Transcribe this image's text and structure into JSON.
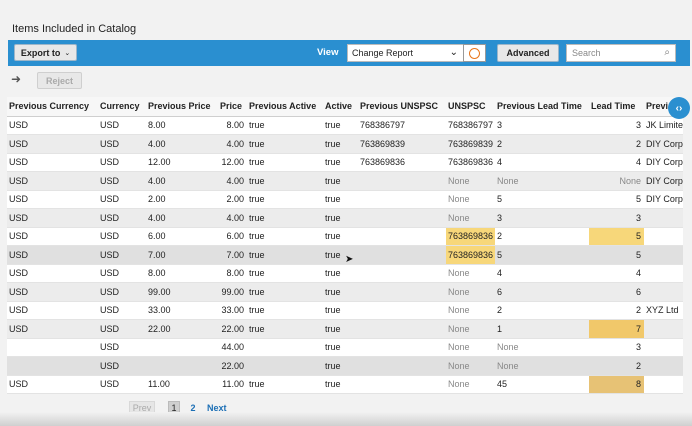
{
  "title": "Items Included in Catalog",
  "toolbar": {
    "export_label": "Export to",
    "view_label": "View",
    "view_value": "Change Report",
    "advanced_label": "Advanced",
    "search_placeholder": "Search"
  },
  "actions": {
    "reject_label": "Reject"
  },
  "columns": [
    "Previous Currency",
    "Currency",
    "Previous Price",
    "Price",
    "Previous Active",
    "Active",
    "Previous UNSPSC",
    "UNSPSC",
    "Previous Lead Time",
    "Lead Time",
    "Previ"
  ],
  "rows": [
    [
      "USD",
      "USD",
      "8.00",
      "8.00",
      "true",
      "true",
      "768386797",
      "768386797",
      "3",
      "3",
      "JK Limite"
    ],
    [
      "USD",
      "USD",
      "4.00",
      "4.00",
      "true",
      "true",
      "763869839",
      "763869839",
      "2",
      "2",
      "DIY Corp"
    ],
    [
      "USD",
      "USD",
      "12.00",
      "12.00",
      "true",
      "true",
      "763869836",
      "763869836",
      "4",
      "4",
      "DIY Corp"
    ],
    [
      "USD",
      "USD",
      "4.00",
      "4.00",
      "true",
      "true",
      "",
      "None",
      "None",
      "None",
      "DIY Corp"
    ],
    [
      "USD",
      "USD",
      "2.00",
      "2.00",
      "true",
      "true",
      "",
      "None",
      "5",
      "5",
      "DIY Corp"
    ],
    [
      "USD",
      "USD",
      "4.00",
      "4.00",
      "true",
      "true",
      "",
      "None",
      "3",
      "3",
      ""
    ],
    [
      "USD",
      "USD",
      "6.00",
      "6.00",
      "true",
      "true",
      "",
      "763869836",
      "2",
      "5",
      ""
    ],
    [
      "USD",
      "USD",
      "7.00",
      "7.00",
      "true",
      "true",
      "",
      "763869836",
      "5",
      "5",
      ""
    ],
    [
      "USD",
      "USD",
      "8.00",
      "8.00",
      "true",
      "true",
      "",
      "None",
      "4",
      "4",
      ""
    ],
    [
      "USD",
      "USD",
      "99.00",
      "99.00",
      "true",
      "true",
      "",
      "None",
      "6",
      "6",
      ""
    ],
    [
      "USD",
      "USD",
      "33.00",
      "33.00",
      "true",
      "true",
      "",
      "None",
      "2",
      "2",
      "XYZ Ltd"
    ],
    [
      "USD",
      "USD",
      "22.00",
      "22.00",
      "true",
      "true",
      "",
      "None",
      "1",
      "7",
      ""
    ],
    [
      "",
      "USD",
      "",
      "44.00",
      "",
      "true",
      "",
      "None",
      "None",
      "3",
      ""
    ],
    [
      "",
      "USD",
      "",
      "22.00",
      "",
      "true",
      "",
      "None",
      "None",
      "2",
      ""
    ],
    [
      "USD",
      "USD",
      "11.00",
      "11.00",
      "true",
      "true",
      "",
      "None",
      "45",
      "8",
      ""
    ]
  ],
  "pager": {
    "prev": "Prev",
    "page1": "1",
    "page2": "2",
    "next": "Next"
  }
}
